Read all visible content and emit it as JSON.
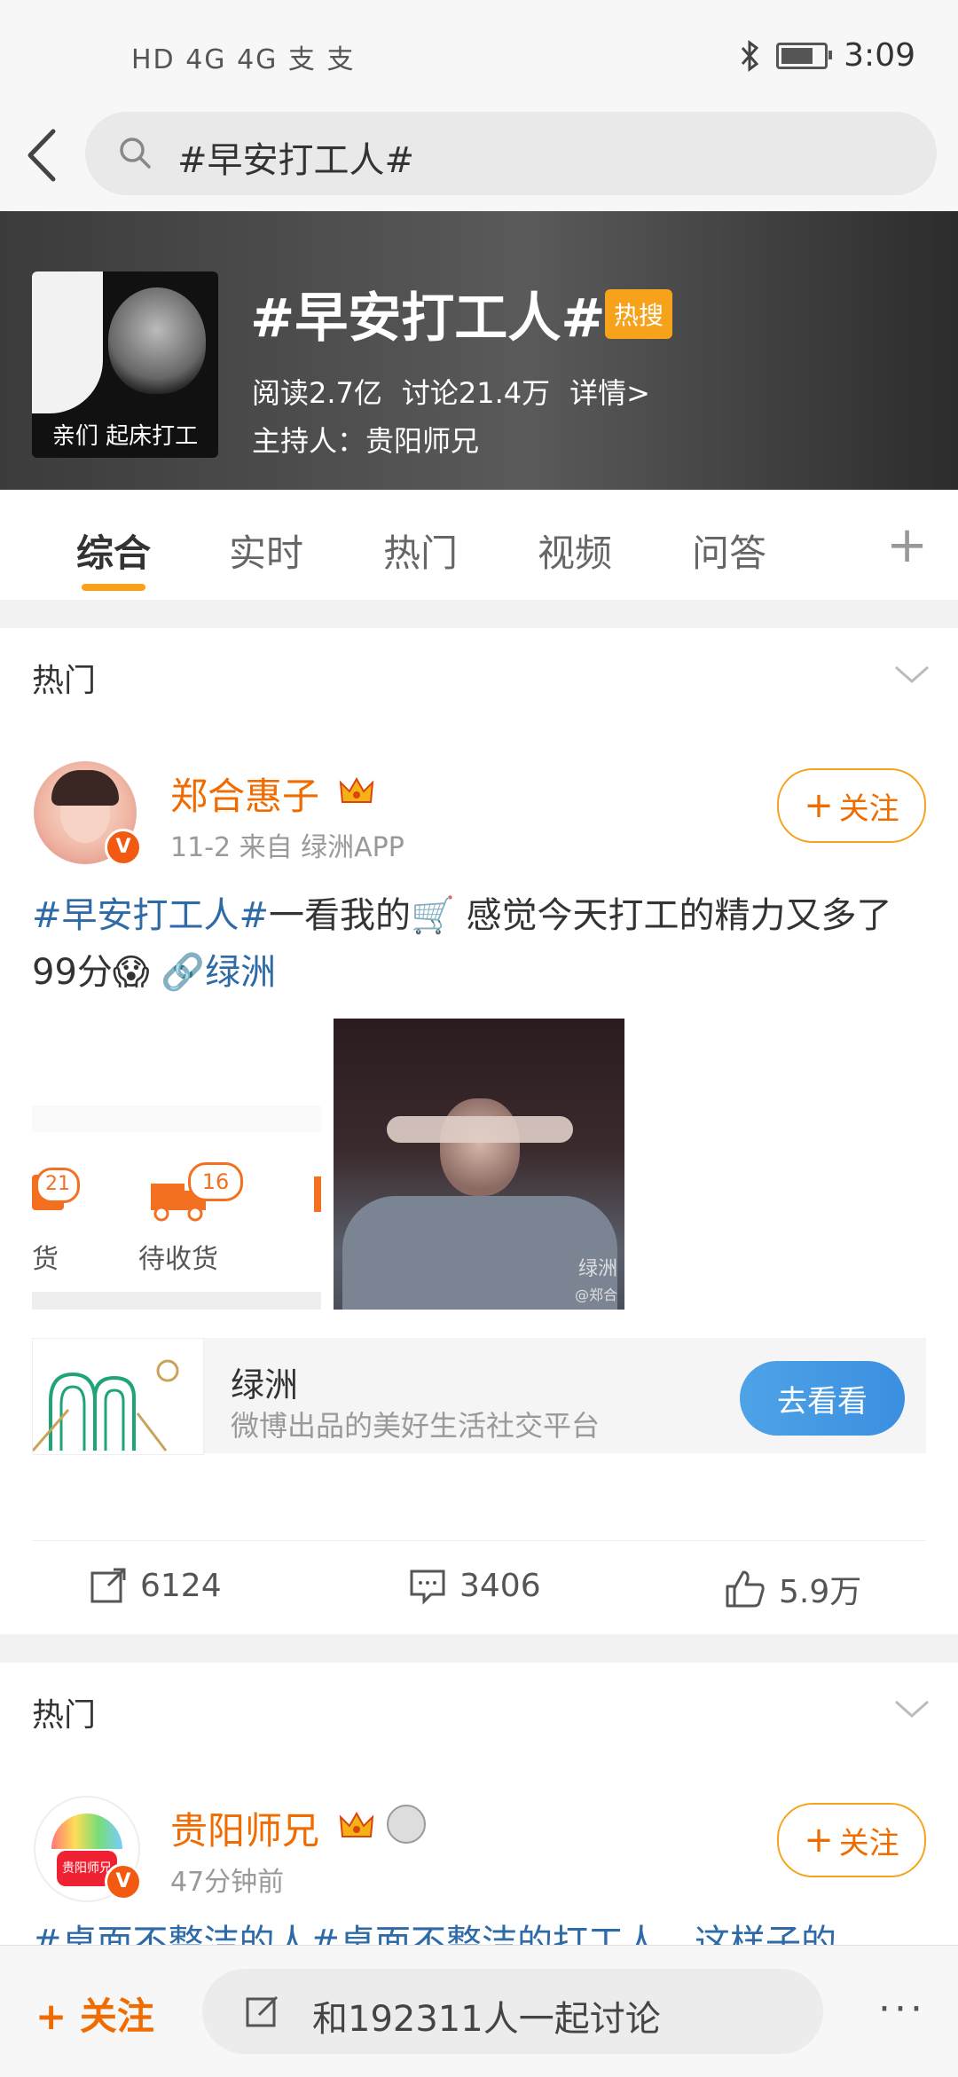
{
  "status_bar": {
    "left_text": "HD 4G 4G 支 支",
    "time": "3:09",
    "battery_level": 0.75
  },
  "search": {
    "query": "#早安打工人#"
  },
  "topic": {
    "image_caption": "亲们 起床打工",
    "title": "#早安打工人#",
    "badge": "热搜",
    "reads": "阅读2.7亿",
    "discussions": "讨论21.4万",
    "details": "详情>",
    "host": "主持人：贵阳师兄"
  },
  "tabs": [
    "综合",
    "实时",
    "热门",
    "视频",
    "问答"
  ],
  "sections": [
    {
      "label": "热门"
    },
    {
      "label": "热门"
    }
  ],
  "post1": {
    "username": "郑合惠子",
    "meta": "11-2  来自 绿洲APP",
    "follow": "关注",
    "text_tag": "#早安打工人#",
    "text_body": "一看我的🛒 感觉今天打工的精力又多了99分😱",
    "text_link": "绿洲",
    "shot_badge_1": "21",
    "shot_badge_2": "16",
    "shot_label_1": "货",
    "shot_label_2": "待收货",
    "photo_watermark_1": "绿洲",
    "photo_watermark_2": "@郑合",
    "app_card": {
      "title": "绿洲",
      "subtitle": "微博出品的美好生活社交平台",
      "button": "去看看"
    },
    "reposts": "6124",
    "comments": "3406",
    "likes": "5.9万"
  },
  "post2": {
    "username": "贵阳师兄",
    "avatar_text": "贵阳师兄",
    "meta": "47分钟前",
    "follow": "关注",
    "text_preview": "#桌面不整洁的人#桌面不整洁的打工人，这样子的"
  },
  "bottom_bar": {
    "follow": "+ 关注",
    "input": "和192311人一起讨论",
    "more": "···"
  }
}
